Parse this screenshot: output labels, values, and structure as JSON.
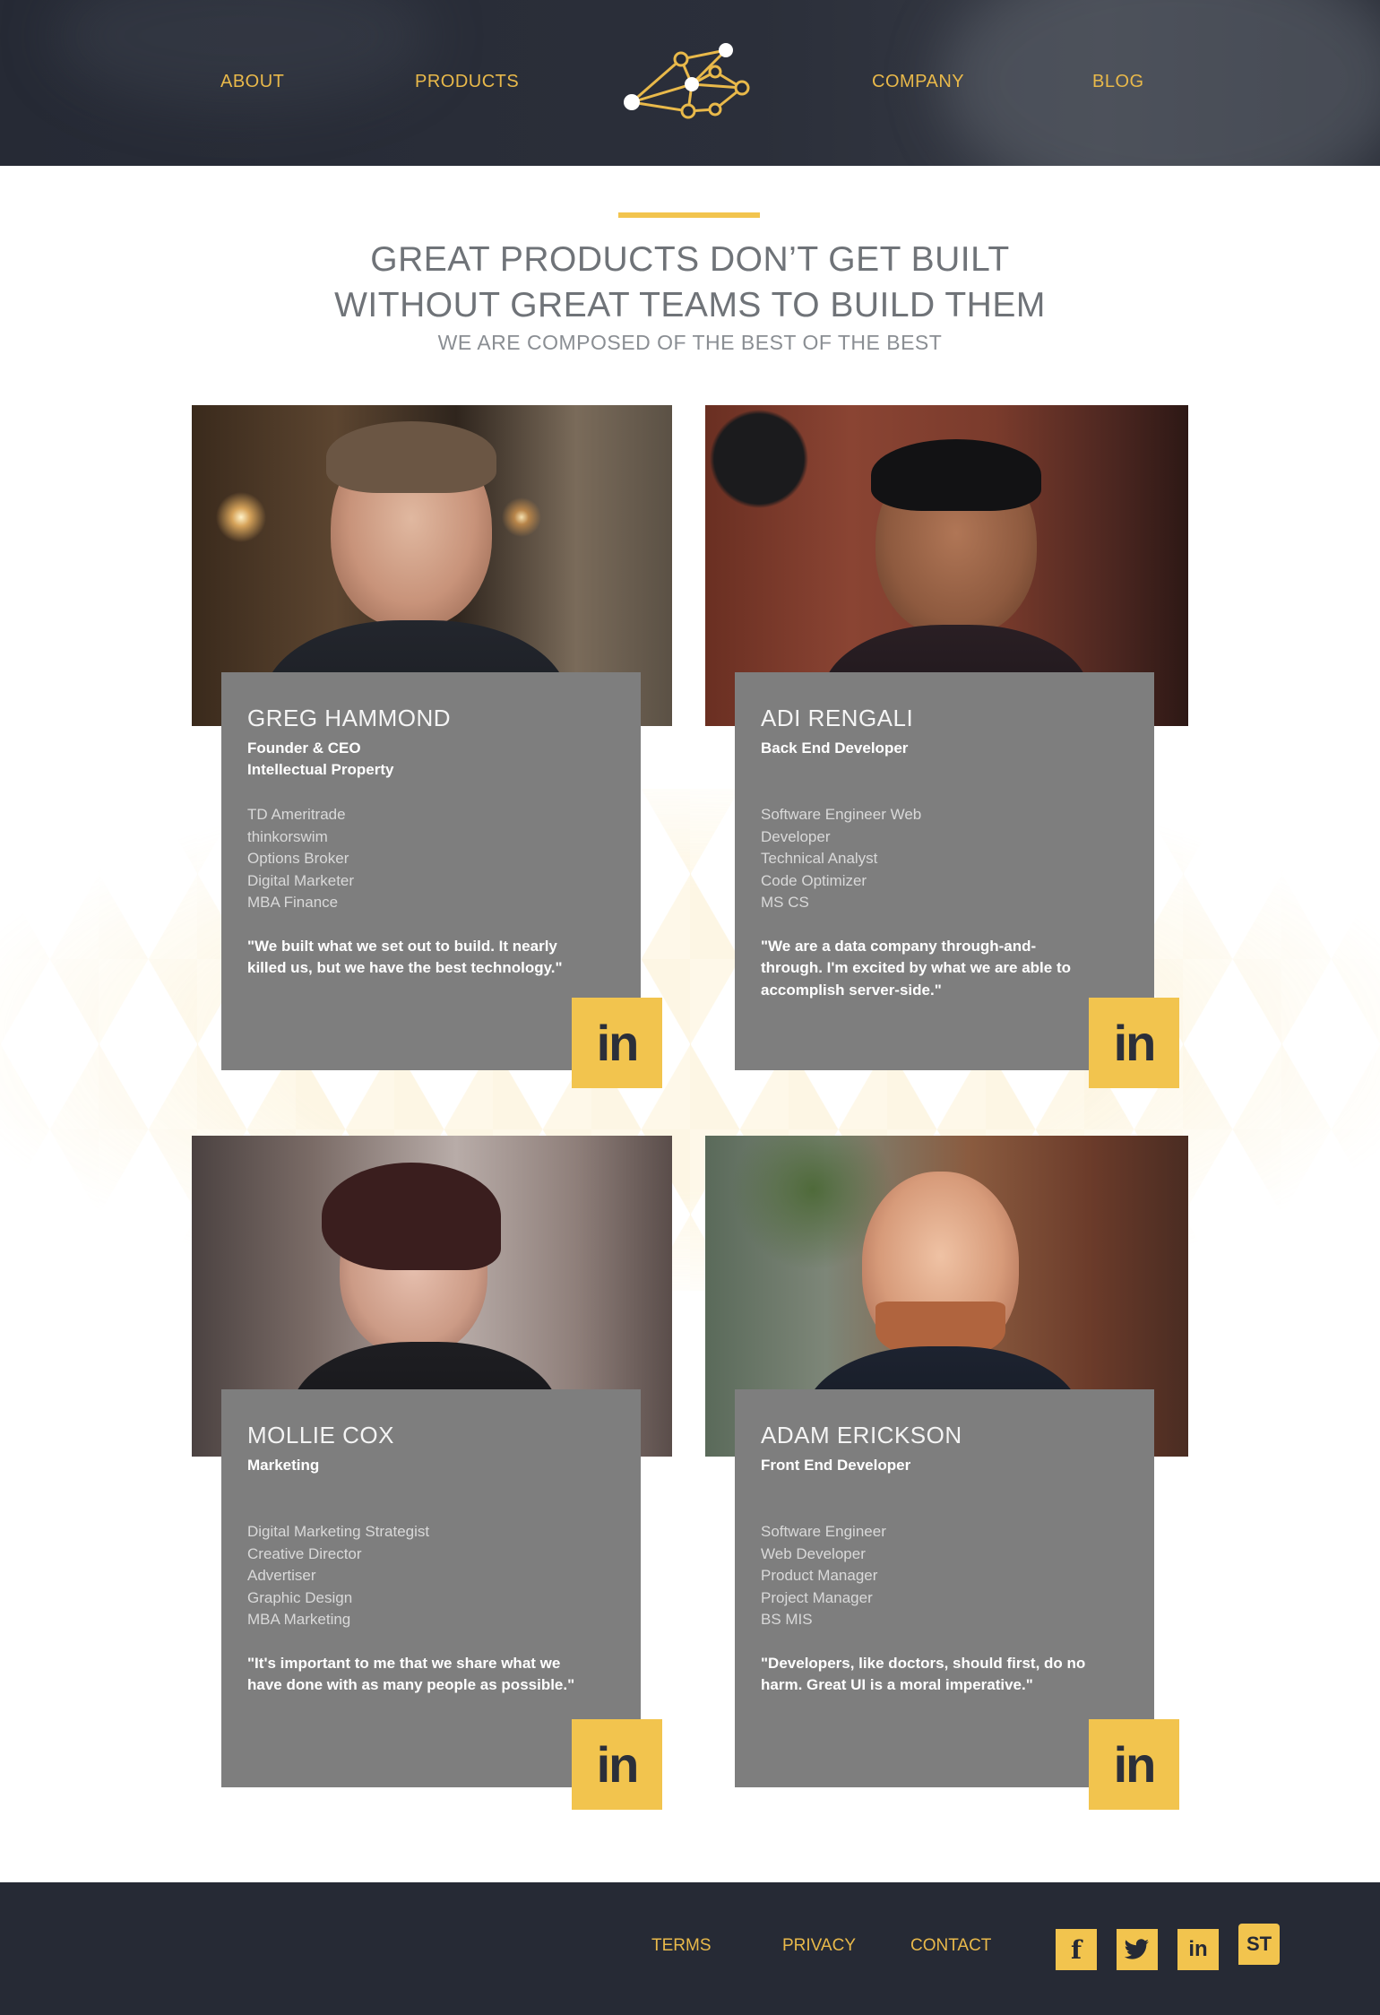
{
  "nav": {
    "about": "ABOUT",
    "products": "PRODUCTS",
    "company": "COMPANY",
    "blog": "BLOG"
  },
  "hero": {
    "title_line1": "GREAT PRODUCTS DON’T GET BUILT",
    "title_line2": "WITHOUT GREAT TEAMS TO BUILD THEM",
    "subtitle": "WE ARE COMPOSED OF THE BEST OF THE BEST"
  },
  "members": [
    {
      "name": "GREG HAMMOND",
      "roles": [
        "Founder & CEO",
        "Intellectual Property"
      ],
      "credentials": [
        "TD Ameritrade",
        "thinkorswim",
        "Options Broker",
        "Digital Marketer",
        "MBA Finance"
      ],
      "quote": "\"We built what we set out to build. It nearly killed us, but we have the best technology.\"",
      "linkedin": "in"
    },
    {
      "name": "ADI RENGALI",
      "roles": [
        "Back End Developer"
      ],
      "credentials": [
        "Software Engineer Web",
        "Developer",
        "Technical Analyst",
        "Code Optimizer",
        "MS CS"
      ],
      "quote": "\"We are a data company through-and-through. I'm excited by what we are able to accomplish server-side.\"",
      "linkedin": "in"
    },
    {
      "name": "MOLLIE COX",
      "roles": [
        "Marketing"
      ],
      "credentials": [
        "Digital Marketing Strategist",
        "Creative Director",
        "Advertiser",
        "Graphic Design",
        "MBA Marketing"
      ],
      "quote": "\"It's important to me that we share what we have done with as many people as possible.\"",
      "linkedin": "in"
    },
    {
      "name": "ADAM ERICKSON",
      "roles": [
        "Front End Developer"
      ],
      "credentials": [
        "Software Engineer",
        "Web Developer",
        "Product Manager",
        "Project Manager",
        "BS MIS"
      ],
      "quote": "\"Developers, like doctors, should first, do no harm. Great UI is a moral imperative.\"",
      "linkedin": "in"
    }
  ],
  "footer": {
    "terms": "TERMS",
    "privacy": "PRIVACY",
    "contact": "CONTACT",
    "social": {
      "facebook": "f",
      "twitter": "twitter-icon",
      "linkedin": "in",
      "st": "ST"
    }
  },
  "colors": {
    "accent": "#f2c44e",
    "header_bg": "#262a35",
    "card_bg": "#7e7e7e"
  }
}
